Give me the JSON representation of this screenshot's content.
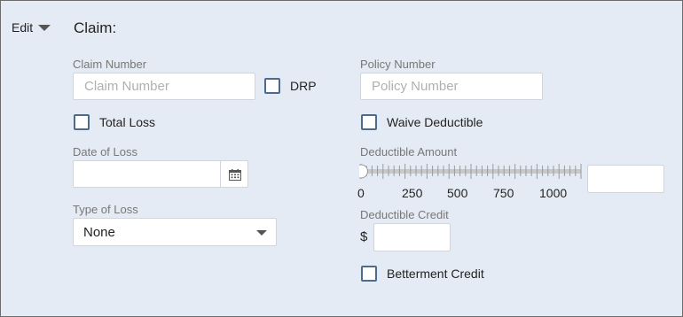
{
  "header": {
    "edit_label": "Edit",
    "title": "Claim:"
  },
  "claim_number": {
    "label": "Claim Number",
    "placeholder": "Claim Number",
    "value": ""
  },
  "drp": {
    "label": "DRP",
    "checked": false
  },
  "policy_number": {
    "label": "Policy Number",
    "placeholder": "Policy Number",
    "value": ""
  },
  "total_loss": {
    "label": "Total Loss",
    "checked": false
  },
  "waive_deductible": {
    "label": "Waive Deductible",
    "checked": false
  },
  "date_of_loss": {
    "label": "Date of Loss",
    "value": ""
  },
  "deductible_amount": {
    "label": "Deductible Amount",
    "slider_value": 0,
    "slider_min": 0,
    "slider_max": 1000,
    "ticks": [
      "0",
      "250",
      "500",
      "750",
      "1000"
    ],
    "value": ""
  },
  "type_of_loss": {
    "label": "Type of Loss",
    "selected": "None"
  },
  "deductible_credit": {
    "label": "Deductible Credit",
    "currency": "$",
    "value": ""
  },
  "betterment_credit": {
    "label": "Betterment Credit",
    "checked": false
  },
  "colors": {
    "panel_bg": "#e5ebf4",
    "checkbox_border": "#4d6a8f",
    "slider_track": "#c8c8c8"
  },
  "icons": [
    "chevron-down-icon",
    "calendar-icon",
    "dropdown-arrow-icon"
  ]
}
